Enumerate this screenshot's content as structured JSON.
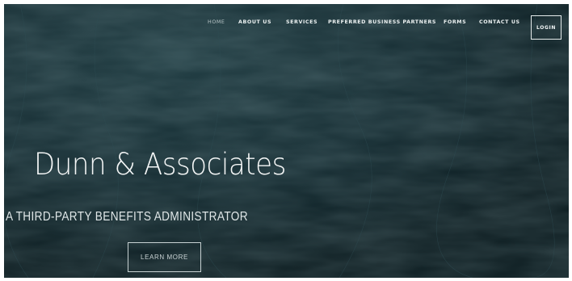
{
  "nav": {
    "items": [
      {
        "label": "HOME"
      },
      {
        "label": "ABOUT US"
      },
      {
        "label": "SERVICES"
      },
      {
        "label": "PREFERRED BUSINESS PARTNERS"
      },
      {
        "label": "FORMS"
      },
      {
        "label": "CONTACT US"
      }
    ],
    "login_label": "LOGIN"
  },
  "hero": {
    "title": "Dunn & Associates",
    "subtitle": "A THIRD-PARTY BENEFITS ADMINISTRATOR",
    "cta_label": "LEARN MORE"
  },
  "colors": {
    "background": "#12262b",
    "text": "#f4f6f6"
  }
}
